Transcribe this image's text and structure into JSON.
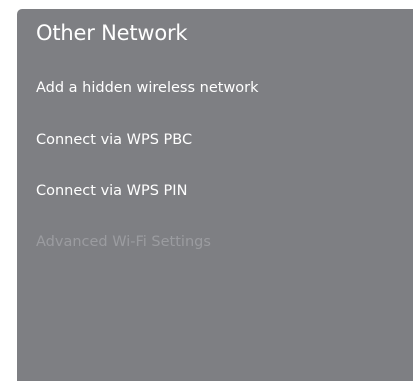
{
  "panel": {
    "title": "Other Network",
    "background_color": "#7e7f83",
    "items": [
      {
        "label": "Add a hidden wireless network",
        "enabled": true
      },
      {
        "label": "Connect via WPS PBC",
        "enabled": true
      },
      {
        "label": "Connect via WPS PIN",
        "enabled": true
      },
      {
        "label": "Advanced Wi-Fi Settings",
        "enabled": false
      }
    ]
  }
}
